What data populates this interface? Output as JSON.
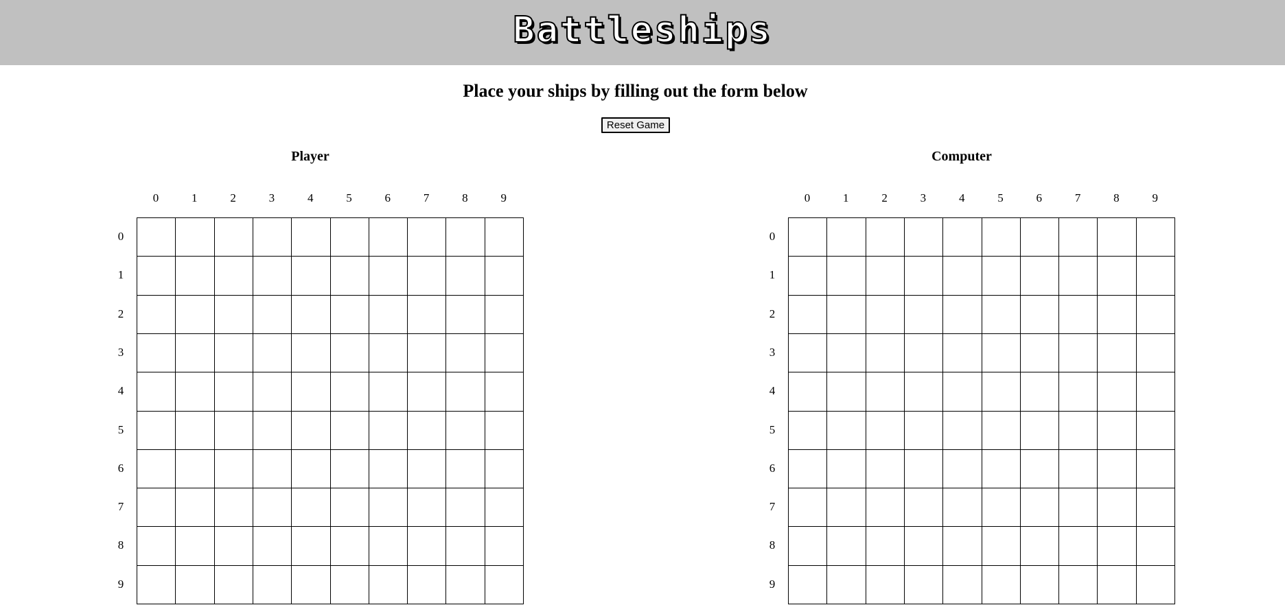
{
  "header": {
    "title": "Battleships",
    "background": "#c0c0c0"
  },
  "instructions": "Place your ships by filling out the form below",
  "controls": {
    "reset_label": "Reset Game"
  },
  "boards": [
    {
      "id": "player",
      "title": "Player",
      "columns": [
        "0",
        "1",
        "2",
        "3",
        "4",
        "5",
        "6",
        "7",
        "8",
        "9"
      ],
      "rows": [
        "0",
        "1",
        "2",
        "3",
        "4",
        "5",
        "6",
        "7",
        "8",
        "9"
      ]
    },
    {
      "id": "computer",
      "title": "Computer",
      "columns": [
        "0",
        "1",
        "2",
        "3",
        "4",
        "5",
        "6",
        "7",
        "8",
        "9"
      ],
      "rows": [
        "0",
        "1",
        "2",
        "3",
        "4",
        "5",
        "6",
        "7",
        "8",
        "9"
      ]
    }
  ]
}
